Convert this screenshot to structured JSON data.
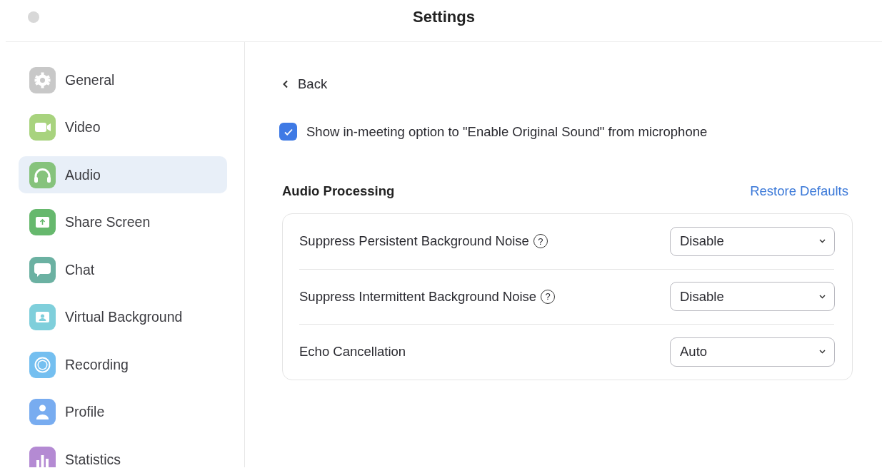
{
  "window": {
    "title": "Settings"
  },
  "sidebar": {
    "items": [
      {
        "label": "General",
        "selected": false
      },
      {
        "label": "Video",
        "selected": false
      },
      {
        "label": "Audio",
        "selected": true
      },
      {
        "label": "Share Screen",
        "selected": false
      },
      {
        "label": "Chat",
        "selected": false
      },
      {
        "label": "Virtual Background",
        "selected": false
      },
      {
        "label": "Recording",
        "selected": false
      },
      {
        "label": "Profile",
        "selected": false
      },
      {
        "label": "Statistics",
        "selected": false
      }
    ]
  },
  "back": {
    "label": "Back"
  },
  "original_sound": {
    "label": "Show in-meeting option to \"Enable Original Sound\" from microphone",
    "checked": true
  },
  "section": {
    "title": "Audio Processing",
    "restore_link": "Restore Defaults"
  },
  "settings": [
    {
      "label": "Suppress Persistent Background Noise",
      "help": "?",
      "value": "Disable"
    },
    {
      "label": "Suppress Intermittent Background Noise",
      "help": "?",
      "value": "Disable"
    },
    {
      "label": "Echo Cancellation",
      "value": "Auto"
    }
  ]
}
